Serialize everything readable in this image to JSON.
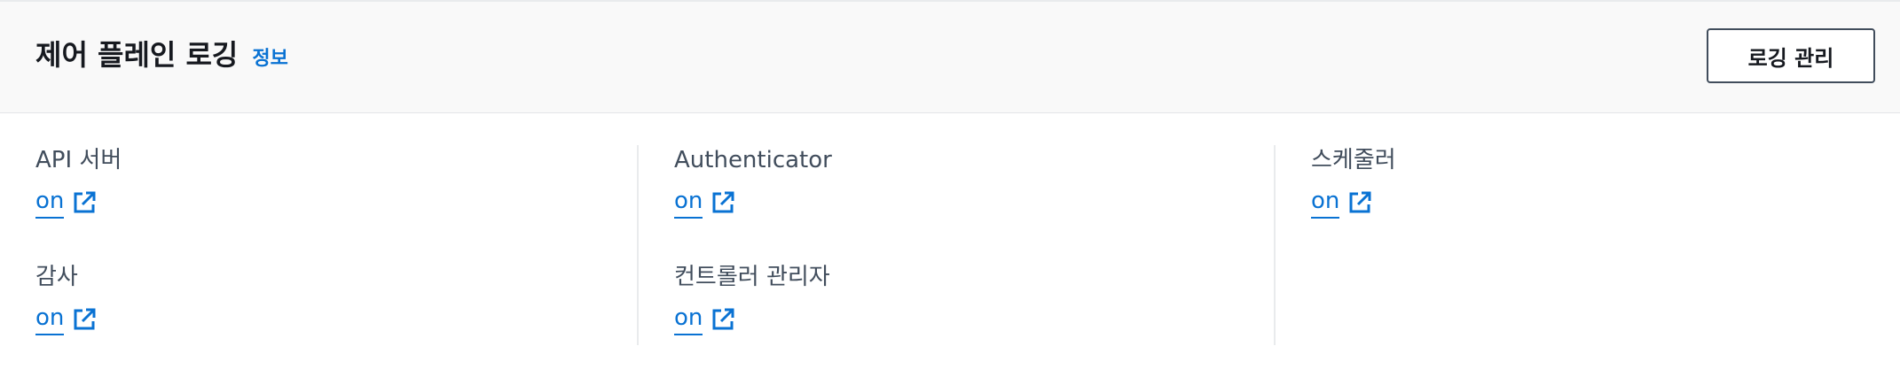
{
  "header": {
    "title": "제어 플레인 로깅",
    "info_link": "정보",
    "manage_button": "로깅 관리"
  },
  "columns": [
    {
      "items": [
        {
          "label": "API 서버",
          "value": "on",
          "icon": "external-link-icon"
        },
        {
          "label": "감사",
          "value": "on",
          "icon": "external-link-icon"
        }
      ]
    },
    {
      "items": [
        {
          "label": "Authenticator",
          "value": "on",
          "icon": "external-link-icon"
        },
        {
          "label": "컨트롤러 관리자",
          "value": "on",
          "icon": "external-link-icon"
        }
      ]
    },
    {
      "items": [
        {
          "label": "스케줄러",
          "value": "on",
          "icon": "external-link-icon"
        }
      ]
    }
  ],
  "colors": {
    "link": "#0972d3",
    "header_bg": "#f9f9f9",
    "divider": "#e9ebed",
    "label": "#414d5c",
    "title": "#16191f"
  }
}
